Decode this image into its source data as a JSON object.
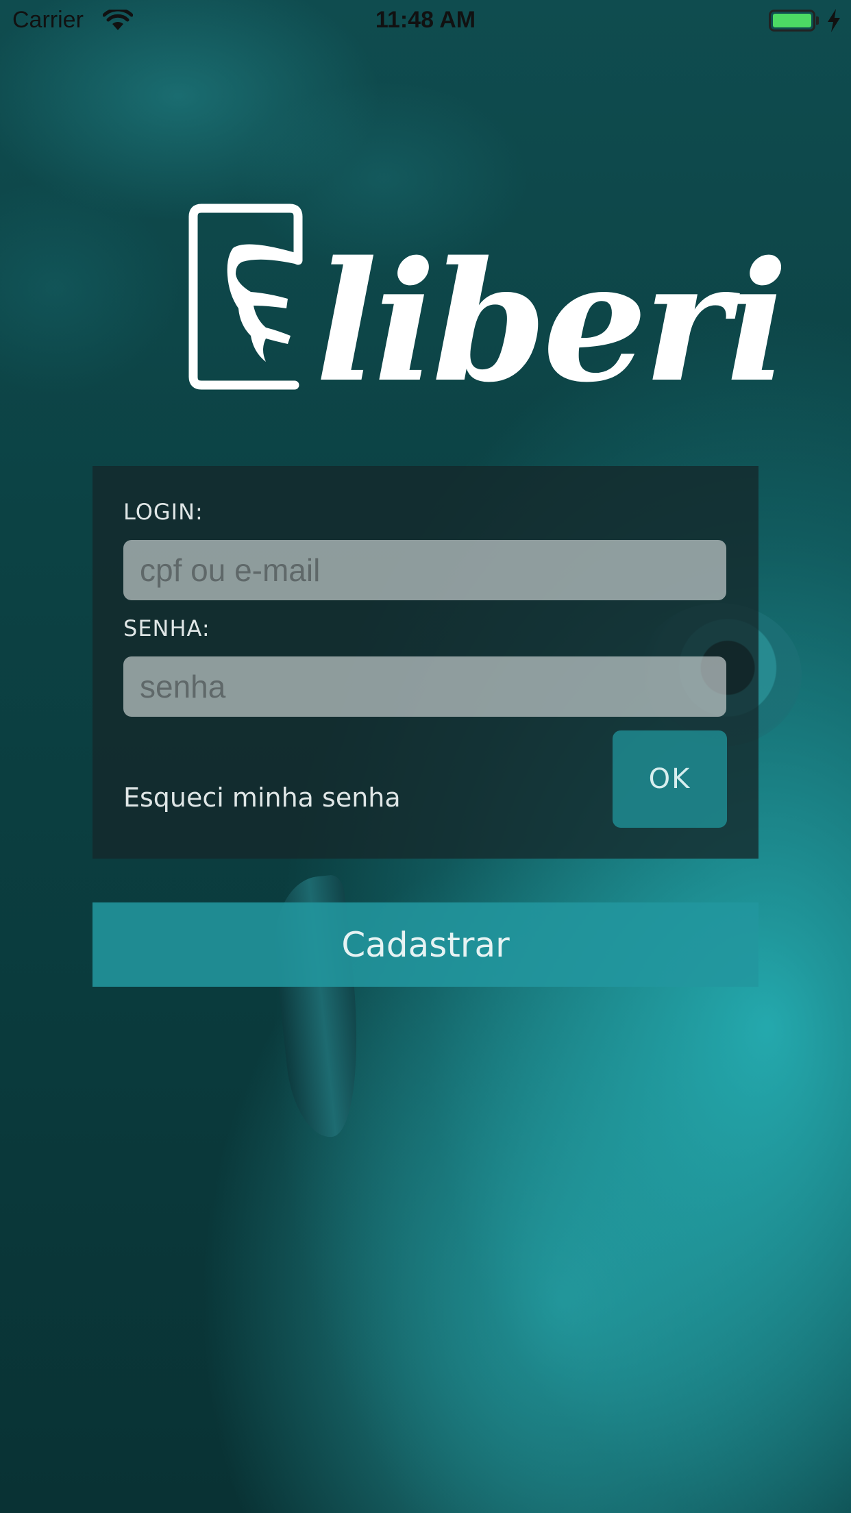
{
  "status_bar": {
    "carrier": "Carrier",
    "time": "11:48 AM",
    "wifi_icon": "wifi-icon",
    "battery_icon": "battery-icon",
    "charging_icon": "bolt-icon"
  },
  "logo": {
    "wordmark": "liberi",
    "icon": "book-hand-icon"
  },
  "login_form": {
    "login_label": "LOGIN:",
    "login_placeholder": "cpf ou e-mail",
    "login_value": "",
    "password_label": "SENHA:",
    "password_placeholder": "senha",
    "password_value": "",
    "forgot_password_label": "Esqueci minha senha",
    "ok_button_label": "OK"
  },
  "register_button_label": "Cadastrar",
  "colors": {
    "accent": "#22969e",
    "battery": "#4cd964",
    "card": "#14282a"
  }
}
